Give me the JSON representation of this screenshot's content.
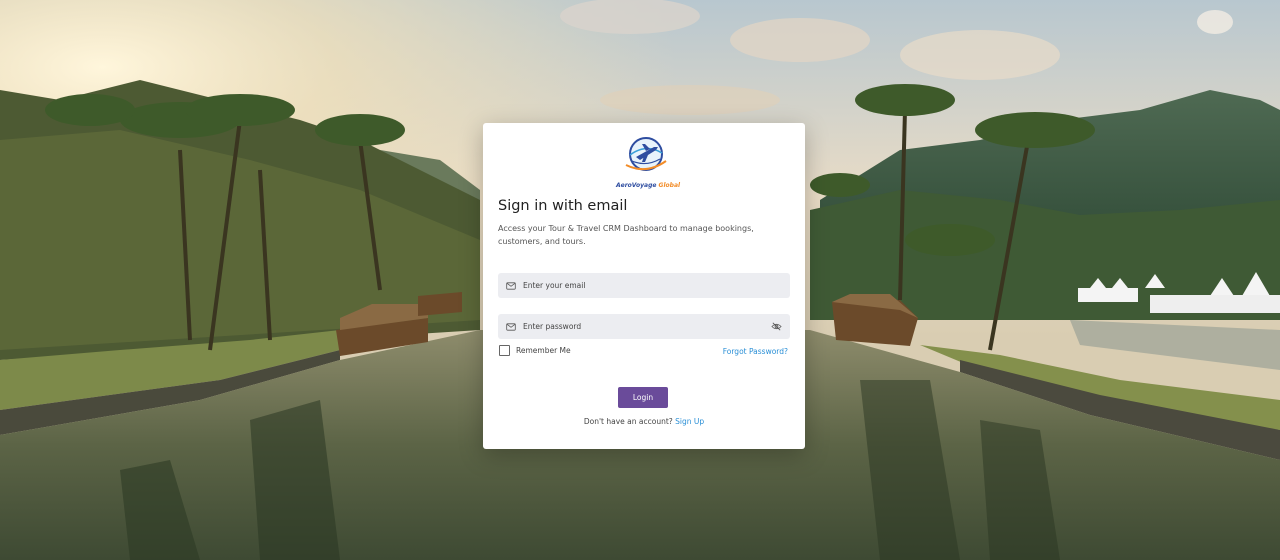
{
  "brand": {
    "name_part1": "AeroVoyage",
    "name_part2": "Global"
  },
  "login": {
    "title": "Sign in with email",
    "subtitle": "Access your Tour & Travel CRM Dashboard to manage bookings, customers, and tours.",
    "email_placeholder": "Enter your email",
    "password_placeholder": "Enter password",
    "remember_label": "Remember Me",
    "forgot_label": "Forgot Password?",
    "login_label": "Login",
    "no_account_text": "Don't have an account?",
    "signup_label": "Sign Up"
  },
  "icons": {
    "email": "mail-icon",
    "password": "lock-icon",
    "toggle": "eye-off-icon",
    "logo": "plane-globe-logo-icon"
  },
  "colors": {
    "primary_button": "#6a4b9a",
    "link": "#2a8fd6",
    "input_bg": "#ecedf1"
  }
}
